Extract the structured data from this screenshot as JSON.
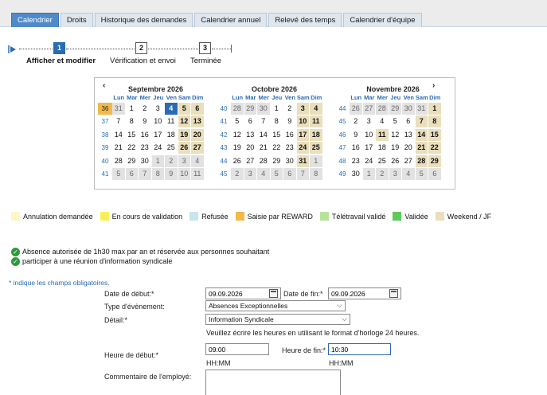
{
  "tabs": [
    {
      "label": "Calendrier",
      "active": true
    },
    {
      "label": "Droits",
      "active": false
    },
    {
      "label": "Historique des demandes",
      "active": false
    },
    {
      "label": "Calendrier annuel",
      "active": false
    },
    {
      "label": "Relevé des temps",
      "active": false
    },
    {
      "label": "Calendrier d'équipe",
      "active": false
    }
  ],
  "stepper": {
    "steps": [
      {
        "number": "1",
        "label": "Afficher et modifier",
        "active": true
      },
      {
        "number": "2",
        "label": "Vérification et envoi",
        "active": false
      },
      {
        "number": "3",
        "label": "Terminée",
        "active": false
      }
    ]
  },
  "calendar": {
    "prev": "‹",
    "next": "›",
    "dow": [
      "Lun",
      "Mar",
      "Mer",
      "Jeu",
      "Ven",
      "Sam",
      "Dim"
    ],
    "months": [
      {
        "title": "Septembre 2026",
        "weeks": [
          {
            "wk": "36",
            "highlight": true,
            "days": [
              [
                "31",
                "o"
              ],
              [
                "1",
                "n"
              ],
              [
                "2",
                "n"
              ],
              [
                "3",
                "n"
              ],
              [
                "4",
                "s"
              ],
              [
                "5",
                "w"
              ],
              [
                "6",
                "w"
              ]
            ]
          },
          {
            "wk": "37",
            "days": [
              [
                "7",
                "n"
              ],
              [
                "8",
                "n"
              ],
              [
                "9",
                "n"
              ],
              [
                "10",
                "n"
              ],
              [
                "11",
                "n"
              ],
              [
                "12",
                "w"
              ],
              [
                "13",
                "w"
              ]
            ]
          },
          {
            "wk": "38",
            "days": [
              [
                "14",
                "n"
              ],
              [
                "15",
                "n"
              ],
              [
                "16",
                "n"
              ],
              [
                "17",
                "n"
              ],
              [
                "18",
                "n"
              ],
              [
                "19",
                "w"
              ],
              [
                "20",
                "w"
              ]
            ]
          },
          {
            "wk": "39",
            "days": [
              [
                "21",
                "n"
              ],
              [
                "22",
                "n"
              ],
              [
                "23",
                "n"
              ],
              [
                "24",
                "n"
              ],
              [
                "25",
                "n"
              ],
              [
                "26",
                "w"
              ],
              [
                "27",
                "w"
              ]
            ]
          },
          {
            "wk": "40",
            "days": [
              [
                "28",
                "n"
              ],
              [
                "29",
                "n"
              ],
              [
                "30",
                "n"
              ],
              [
                "1",
                "o"
              ],
              [
                "2",
                "o"
              ],
              [
                "3",
                "o"
              ],
              [
                "4",
                "o"
              ]
            ]
          },
          {
            "wk": "41",
            "days": [
              [
                "5",
                "o"
              ],
              [
                "6",
                "o"
              ],
              [
                "7",
                "o"
              ],
              [
                "8",
                "o"
              ],
              [
                "9",
                "o"
              ],
              [
                "10",
                "o"
              ],
              [
                "11",
                "o"
              ]
            ]
          }
        ]
      },
      {
        "title": "Octobre 2026",
        "weeks": [
          {
            "wk": "40",
            "days": [
              [
                "28",
                "o"
              ],
              [
                "29",
                "o"
              ],
              [
                "30",
                "o"
              ],
              [
                "1",
                "n"
              ],
              [
                "2",
                "n"
              ],
              [
                "3",
                "w"
              ],
              [
                "4",
                "w"
              ]
            ]
          },
          {
            "wk": "41",
            "days": [
              [
                "5",
                "n"
              ],
              [
                "6",
                "n"
              ],
              [
                "7",
                "n"
              ],
              [
                "8",
                "n"
              ],
              [
                "9",
                "n"
              ],
              [
                "10",
                "w"
              ],
              [
                "11",
                "w"
              ]
            ]
          },
          {
            "wk": "42",
            "days": [
              [
                "12",
                "n"
              ],
              [
                "13",
                "n"
              ],
              [
                "14",
                "n"
              ],
              [
                "15",
                "n"
              ],
              [
                "16",
                "n"
              ],
              [
                "17",
                "w"
              ],
              [
                "18",
                "w"
              ]
            ]
          },
          {
            "wk": "43",
            "days": [
              [
                "19",
                "n"
              ],
              [
                "20",
                "n"
              ],
              [
                "21",
                "n"
              ],
              [
                "22",
                "n"
              ],
              [
                "23",
                "n"
              ],
              [
                "24",
                "w"
              ],
              [
                "25",
                "w"
              ]
            ]
          },
          {
            "wk": "44",
            "days": [
              [
                "26",
                "n"
              ],
              [
                "27",
                "n"
              ],
              [
                "28",
                "n"
              ],
              [
                "29",
                "n"
              ],
              [
                "30",
                "n"
              ],
              [
                "31",
                "w"
              ],
              [
                "1",
                "o"
              ]
            ]
          },
          {
            "wk": "45",
            "days": [
              [
                "2",
                "o"
              ],
              [
                "3",
                "o"
              ],
              [
                "4",
                "o"
              ],
              [
                "5",
                "o"
              ],
              [
                "6",
                "o"
              ],
              [
                "7",
                "o"
              ],
              [
                "8",
                "o"
              ]
            ]
          }
        ]
      },
      {
        "title": "Novembre 2026",
        "weeks": [
          {
            "wk": "44",
            "days": [
              [
                "26",
                "o"
              ],
              [
                "27",
                "o"
              ],
              [
                "28",
                "o"
              ],
              [
                "29",
                "o"
              ],
              [
                "30",
                "o"
              ],
              [
                "31",
                "o"
              ],
              [
                "1",
                "w"
              ]
            ]
          },
          {
            "wk": "45",
            "days": [
              [
                "2",
                "n"
              ],
              [
                "3",
                "n"
              ],
              [
                "4",
                "n"
              ],
              [
                "5",
                "n"
              ],
              [
                "6",
                "n"
              ],
              [
                "7",
                "w"
              ],
              [
                "8",
                "w"
              ]
            ]
          },
          {
            "wk": "46",
            "days": [
              [
                "9",
                "n"
              ],
              [
                "10",
                "n"
              ],
              [
                "11",
                "w"
              ],
              [
                "12",
                "n"
              ],
              [
                "13",
                "n"
              ],
              [
                "14",
                "w"
              ],
              [
                "15",
                "w"
              ]
            ]
          },
          {
            "wk": "47",
            "days": [
              [
                "16",
                "n"
              ],
              [
                "17",
                "n"
              ],
              [
                "18",
                "n"
              ],
              [
                "19",
                "n"
              ],
              [
                "20",
                "n"
              ],
              [
                "21",
                "w"
              ],
              [
                "22",
                "w"
              ]
            ]
          },
          {
            "wk": "48",
            "days": [
              [
                "23",
                "n"
              ],
              [
                "24",
                "n"
              ],
              [
                "25",
                "n"
              ],
              [
                "26",
                "n"
              ],
              [
                "27",
                "n"
              ],
              [
                "28",
                "w"
              ],
              [
                "29",
                "w"
              ]
            ]
          },
          {
            "wk": "49",
            "days": [
              [
                "30",
                "n"
              ],
              [
                "1",
                "o"
              ],
              [
                "2",
                "o"
              ],
              [
                "3",
                "o"
              ],
              [
                "4",
                "o"
              ],
              [
                "5",
                "o"
              ],
              [
                "6",
                "o"
              ]
            ]
          }
        ]
      }
    ]
  },
  "legend": [
    {
      "label": "Annulation demandée",
      "color": "#fdf6c6"
    },
    {
      "label": "En cours de validation",
      "color": "#f7ef5a"
    },
    {
      "label": "Refusée",
      "color": "#c6e7ec"
    },
    {
      "label": "Saisie par REWARD",
      "color": "#f0b94a"
    },
    {
      "label": "Télétravail validé",
      "color": "#b6e29c"
    },
    {
      "label": "Validée",
      "color": "#5fc95a"
    },
    {
      "label": "Weekend / JF",
      "color": "#eadfbd"
    }
  ],
  "info": [
    "Absence autorisée de 1h30 max par an et réservée aux personnes souhaitant",
    "participer à une réunion d'information syndicale"
  ],
  "required_note": "* indique les champs obligatoires.",
  "form": {
    "start_date_label": "Date de début:*",
    "start_date_value": "09.09.2026",
    "end_date_label": "Date de fin:*",
    "end_date_value": "09.09.2026",
    "type_label": "Type d'évènement:",
    "type_value": "Absences Exceptionnelles",
    "detail_label": "Détail:*",
    "detail_value": "Information Syndicale",
    "format_hint": "Veuillez écrire les heures en utilisant le format d'horloge 24 heures.",
    "start_time_label": "Heure de début:*",
    "start_time_value": "09:00",
    "end_time_label": "Heure de fin:*",
    "end_time_value": "10:30",
    "time_format": "HH:MM",
    "comment_label": "Commentaire de l'employé:"
  }
}
